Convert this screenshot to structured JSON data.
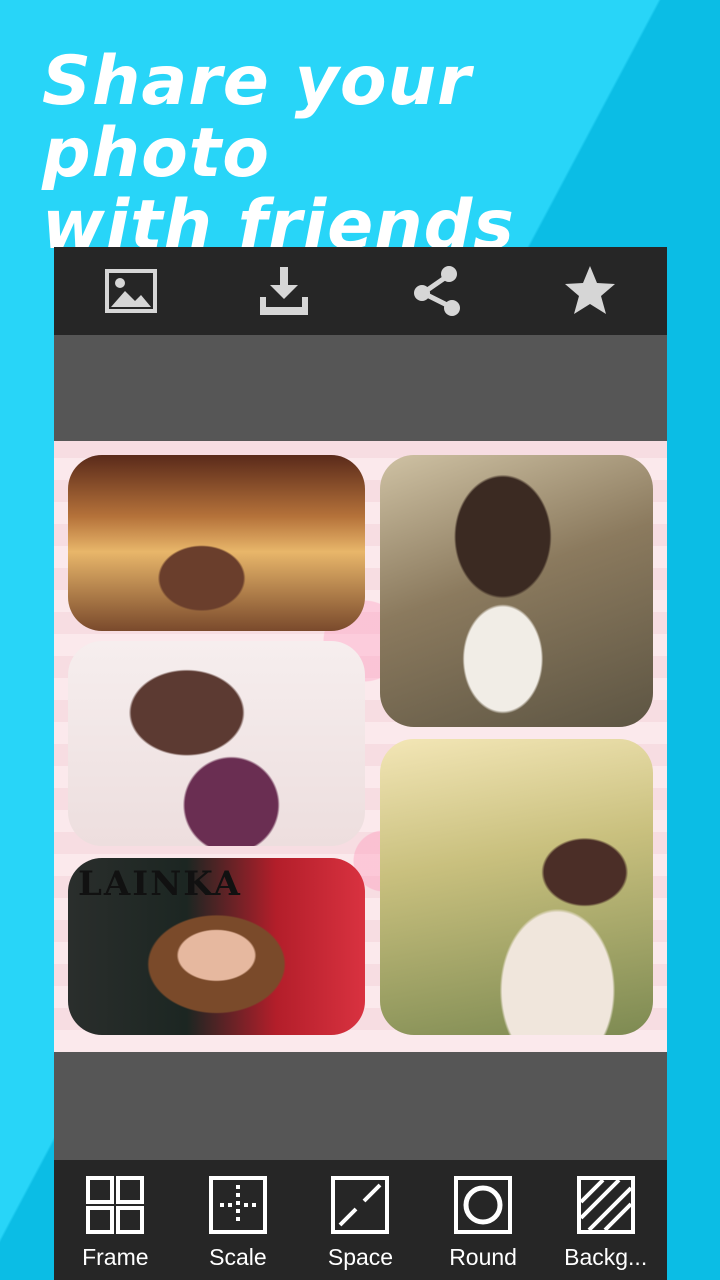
{
  "promo": {
    "headline_line1": "Share your photo",
    "headline_line2": "with friends"
  },
  "toolbar": {
    "items": [
      {
        "icon": "image-icon"
      },
      {
        "icon": "download-icon"
      },
      {
        "icon": "share-icon"
      },
      {
        "icon": "star-icon"
      }
    ]
  },
  "collage": {
    "photo5_text": "LAINKA"
  },
  "tools": {
    "items": [
      {
        "label": "Frame",
        "icon": "frame-icon"
      },
      {
        "label": "Scale",
        "icon": "scale-icon"
      },
      {
        "label": "Space",
        "icon": "space-icon"
      },
      {
        "label": "Round",
        "icon": "round-icon"
      },
      {
        "label": "Backg...",
        "icon": "background-icon"
      }
    ]
  },
  "colors": {
    "background": "#1cc7ec",
    "bar": "#262626",
    "workspace": "#565656",
    "icon": "#d6d6d6"
  }
}
